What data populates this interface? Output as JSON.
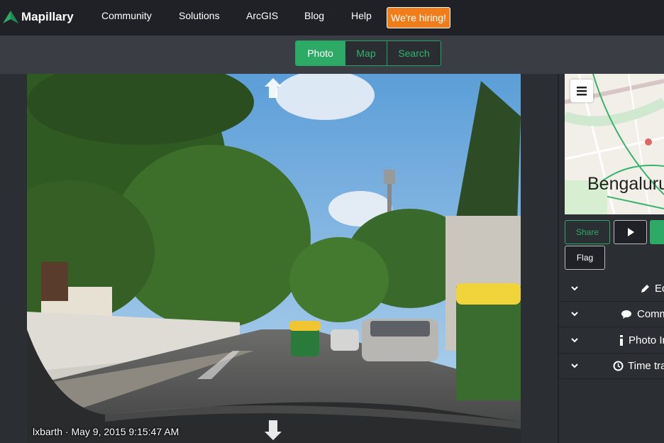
{
  "brand": {
    "name": "Mapillary"
  },
  "nav": {
    "links": [
      "Community",
      "Solutions",
      "ArcGIS",
      "Blog",
      "Help"
    ],
    "hiring_label": "We're hiring!"
  },
  "view_tabs": {
    "photo": "Photo",
    "map": "Map",
    "search": "Search",
    "active": "Photo"
  },
  "photo": {
    "caption": "lxbarth · May 9, 2015 9:15:47 AM"
  },
  "minimap": {
    "city_label": "Bengaluru"
  },
  "actions": {
    "share": "Share",
    "flag": "Flag"
  },
  "panels": [
    "Edit",
    "Comments",
    "Photo Info",
    "Time travel"
  ],
  "colors": {
    "accent": "#2eaa67",
    "hiring": "#f07d1b",
    "topbar": "#1f2126"
  }
}
